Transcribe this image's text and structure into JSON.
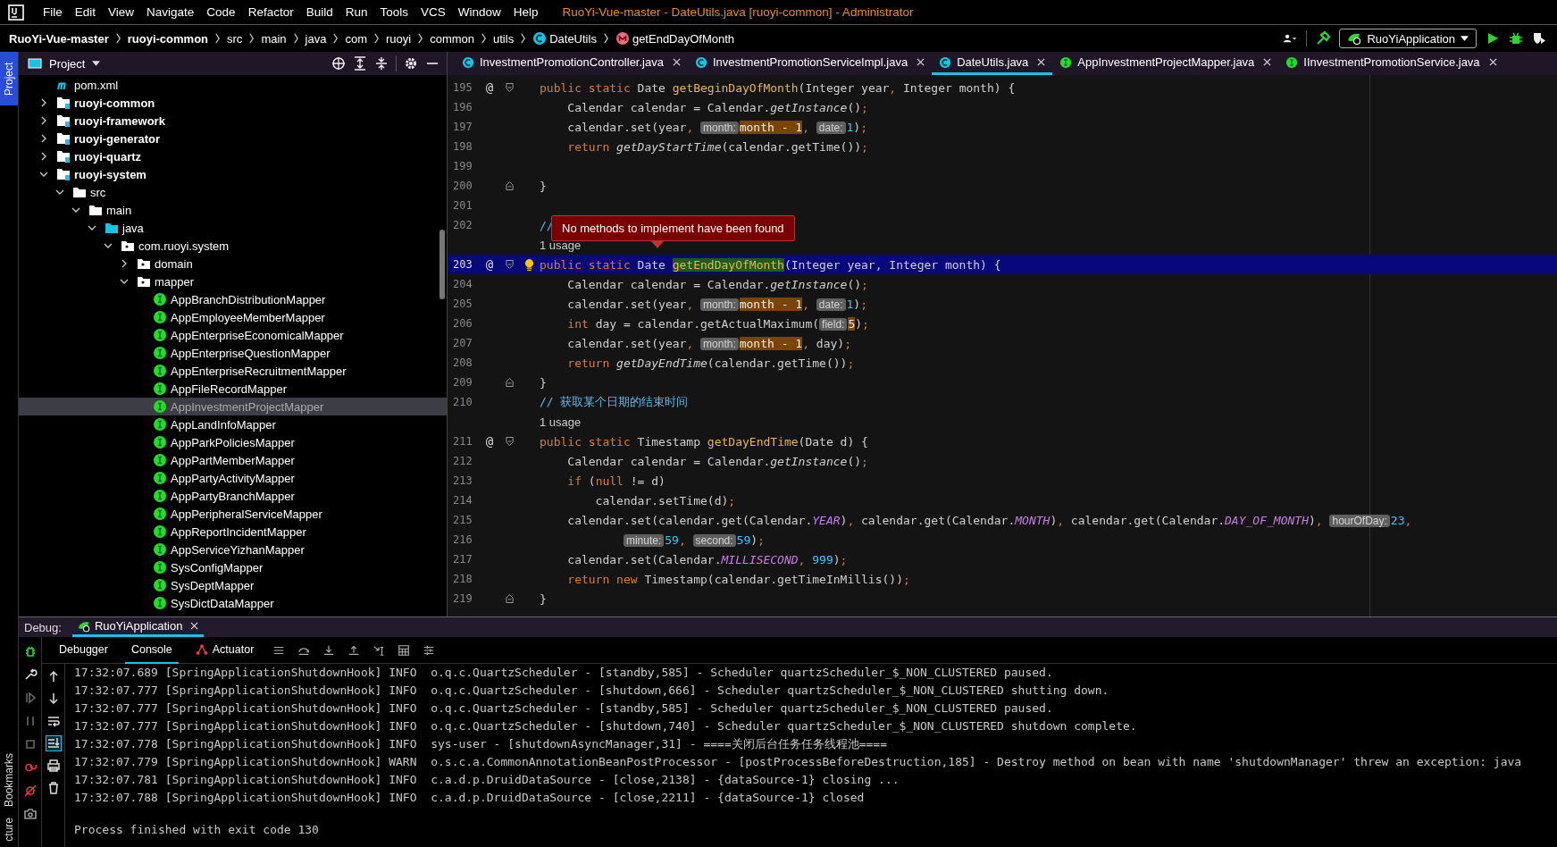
{
  "title_bar": {
    "menu": [
      "File",
      "Edit",
      "View",
      "Navigate",
      "Code",
      "Refactor",
      "Build",
      "Run",
      "Tools",
      "VCS",
      "Window",
      "Help"
    ],
    "title": "RuoYi-Vue-master - DateUtils.java [ruoyi-common] - Administrator"
  },
  "breadcrumb": [
    {
      "label": "RuoYi-Vue-master",
      "kind": "project"
    },
    {
      "label": "ruoyi-common",
      "kind": "project"
    },
    {
      "label": "src",
      "kind": "folder"
    },
    {
      "label": "main",
      "kind": "folder"
    },
    {
      "label": "java",
      "kind": "folder"
    },
    {
      "label": "com",
      "kind": "folder"
    },
    {
      "label": "ruoyi",
      "kind": "folder"
    },
    {
      "label": "common",
      "kind": "folder"
    },
    {
      "label": "utils",
      "kind": "folder"
    },
    {
      "label": "DateUtils",
      "kind": "class"
    },
    {
      "label": "getEndDayOfMonth",
      "kind": "method"
    }
  ],
  "run_config": "RuoYiApplication",
  "left_stripe": {
    "top": "Project",
    "bottom": [
      "Bookmarks",
      "cture"
    ]
  },
  "project_panel": {
    "title": "Project",
    "tree": [
      {
        "label": "pom.xml",
        "kind": "maven"
      },
      {
        "label": "ruoyi-common",
        "kind": "module",
        "expanded": false
      },
      {
        "label": "ruoyi-framework",
        "kind": "module",
        "expanded": false
      },
      {
        "label": "ruoyi-generator",
        "kind": "module",
        "expanded": false
      },
      {
        "label": "ruoyi-quartz",
        "kind": "module",
        "expanded": false
      },
      {
        "label": "ruoyi-system",
        "kind": "module",
        "expanded": true,
        "children": [
          {
            "label": "src",
            "kind": "folder",
            "expanded": true,
            "children": [
              {
                "label": "main",
                "kind": "folder",
                "expanded": true,
                "children": [
                  {
                    "label": "java",
                    "kind": "source",
                    "expanded": true,
                    "children": [
                      {
                        "label": "com.ruoyi.system",
                        "kind": "package",
                        "expanded": true,
                        "children": [
                          {
                            "label": "domain",
                            "kind": "package",
                            "expanded": false
                          },
                          {
                            "label": "mapper",
                            "kind": "package",
                            "expanded": true,
                            "children": [
                              {
                                "label": "AppBranchDistributionMapper",
                                "kind": "interface",
                                "selected": false
                              },
                              {
                                "label": "AppEmployeeMemberMapper",
                                "kind": "interface",
                                "selected": false
                              },
                              {
                                "label": "AppEnterpriseEconomicalMapper",
                                "kind": "interface",
                                "selected": false
                              },
                              {
                                "label": "AppEnterpriseQuestionMapper",
                                "kind": "interface",
                                "selected": false
                              },
                              {
                                "label": "AppEnterpriseRecruitmentMapper",
                                "kind": "interface",
                                "selected": false
                              },
                              {
                                "label": "AppFileRecordMapper",
                                "kind": "interface",
                                "selected": false
                              },
                              {
                                "label": "AppInvestmentProjectMapper",
                                "kind": "interface",
                                "selected": true
                              },
                              {
                                "label": "AppLandInfoMapper",
                                "kind": "interface",
                                "selected": false
                              },
                              {
                                "label": "AppParkPoliciesMapper",
                                "kind": "interface",
                                "selected": false
                              },
                              {
                                "label": "AppPartMemberMapper",
                                "kind": "interface",
                                "selected": false
                              },
                              {
                                "label": "AppPartyActivityMapper",
                                "kind": "interface",
                                "selected": false
                              },
                              {
                                "label": "AppPartyBranchMapper",
                                "kind": "interface",
                                "selected": false
                              },
                              {
                                "label": "AppPeripheralServiceMapper",
                                "kind": "interface",
                                "selected": false
                              },
                              {
                                "label": "AppReportIncidentMapper",
                                "kind": "interface",
                                "selected": false
                              },
                              {
                                "label": "AppServiceYizhanMapper",
                                "kind": "interface",
                                "selected": false
                              },
                              {
                                "label": "SysConfigMapper",
                                "kind": "interface",
                                "selected": false
                              },
                              {
                                "label": "SysDeptMapper",
                                "kind": "interface",
                                "selected": false
                              },
                              {
                                "label": "SysDictDataMapper",
                                "kind": "interface",
                                "selected": false
                              }
                            ]
                          }
                        ]
                      }
                    ]
                  }
                ]
              }
            ]
          }
        ]
      }
    ]
  },
  "editor_tabs": [
    {
      "label": "InvestmentPromotionController.java",
      "kind": "class",
      "selected": false
    },
    {
      "label": "InvestmentPromotionServiceImpl.java",
      "kind": "class",
      "selected": false
    },
    {
      "label": "DateUtils.java",
      "kind": "class",
      "selected": true
    },
    {
      "label": "AppInvestmentProjectMapper.java",
      "kind": "interface",
      "selected": false
    },
    {
      "label": "IInvestmentPromotionService.java",
      "kind": "interface",
      "selected": false
    }
  ],
  "editor": {
    "tooltip": "No methods to implement have been found",
    "lines": [
      {
        "kind": "code",
        "number": "195",
        "gutter": "@",
        "fold_start": true,
        "current": false,
        "tokens": [
          {
            "kind": "kw",
            "text": "public static "
          },
          {
            "kind": "plain",
            "text": "Date "
          },
          {
            "kind": "decl",
            "text": "getBeginDayOfMonth"
          },
          {
            "kind": "plain",
            "text": "(Integer year"
          },
          {
            "kind": "punct",
            "text": ", "
          },
          {
            "kind": "plain",
            "text": "Integer month) {"
          }
        ]
      },
      {
        "kind": "code",
        "number": "196",
        "current": false,
        "tokens": [
          {
            "kind": "plain",
            "text": "    Calendar calendar = Calendar."
          },
          {
            "kind": "italic",
            "text": "getInstance"
          },
          {
            "kind": "plain",
            "text": "()"
          },
          {
            "kind": "punct",
            "text": ";"
          }
        ]
      },
      {
        "kind": "code",
        "number": "197",
        "current": false,
        "tokens": [
          {
            "kind": "plain",
            "text": "    calendar.set(year"
          },
          {
            "kind": "punct",
            "text": ", "
          },
          {
            "kind": "hint",
            "text": "month:"
          },
          {
            "kind": "arg",
            "text": "month - 1"
          },
          {
            "kind": "punct",
            "text": ", "
          },
          {
            "kind": "hint",
            "text": "date:"
          },
          {
            "kind": "num",
            "text": "1"
          },
          {
            "kind": "plain",
            "text": ")"
          },
          {
            "kind": "punct",
            "text": ";"
          }
        ]
      },
      {
        "kind": "code",
        "number": "198",
        "current": false,
        "tokens": [
          {
            "kind": "kw",
            "text": "    return "
          },
          {
            "kind": "italic",
            "text": "getDayStartTime"
          },
          {
            "kind": "plain",
            "text": "(calendar.getTime())"
          },
          {
            "kind": "punct",
            "text": ";"
          }
        ]
      },
      {
        "kind": "code",
        "number": "199",
        "current": false
      },
      {
        "kind": "code",
        "number": "200",
        "fold_end": true,
        "current": false,
        "tokens": [
          {
            "kind": "plain",
            "text": "}"
          }
        ]
      },
      {
        "kind": "code",
        "number": "201",
        "current": false
      },
      {
        "kind": "code",
        "number": "202",
        "current": false,
        "tokens": [
          {
            "kind": "comment",
            "text": "//"
          }
        ]
      },
      {
        "kind": "usage",
        "text": "1 usage"
      },
      {
        "kind": "code",
        "number": "203",
        "gutter": "@",
        "fold_start": true,
        "bulb": true,
        "current": true,
        "tokens": [
          {
            "kind": "kw",
            "text": "public static "
          },
          {
            "kind": "plain",
            "text": "Date "
          },
          {
            "kind": "match",
            "text": "getEndDayOfMonth"
          },
          {
            "kind": "plain",
            "text": "(Integer year, Integer month) {"
          }
        ]
      },
      {
        "kind": "code",
        "number": "204",
        "current": false,
        "tokens": [
          {
            "kind": "plain",
            "text": "    Calendar calendar = Calendar."
          },
          {
            "kind": "italic",
            "text": "getInstance"
          },
          {
            "kind": "plain",
            "text": "()"
          },
          {
            "kind": "punct",
            "text": ";"
          }
        ]
      },
      {
        "kind": "code",
        "number": "205",
        "current": false,
        "tokens": [
          {
            "kind": "plain",
            "text": "    calendar.set(year"
          },
          {
            "kind": "punct",
            "text": ", "
          },
          {
            "kind": "hint",
            "text": "month:"
          },
          {
            "kind": "arg",
            "text": "month - 1"
          },
          {
            "kind": "punct",
            "text": ", "
          },
          {
            "kind": "hint",
            "text": "date:"
          },
          {
            "kind": "num",
            "text": "1"
          },
          {
            "kind": "plain",
            "text": ")"
          },
          {
            "kind": "punct",
            "text": ";"
          }
        ]
      },
      {
        "kind": "code",
        "number": "206",
        "current": false,
        "tokens": [
          {
            "kind": "kw",
            "text": "    int "
          },
          {
            "kind": "plain",
            "text": "day = calendar.getActualMaximum("
          },
          {
            "kind": "hint",
            "text": "field:"
          },
          {
            "kind": "arg",
            "text": "5"
          },
          {
            "kind": "plain",
            "text": ")"
          },
          {
            "kind": "punct",
            "text": ";"
          }
        ]
      },
      {
        "kind": "code",
        "number": "207",
        "current": false,
        "tokens": [
          {
            "kind": "plain",
            "text": "    calendar.set(year"
          },
          {
            "kind": "punct",
            "text": ", "
          },
          {
            "kind": "hint",
            "text": "month:"
          },
          {
            "kind": "arg",
            "text": "month - 1"
          },
          {
            "kind": "punct",
            "text": ", "
          },
          {
            "kind": "plain",
            "text": "day)"
          },
          {
            "kind": "punct",
            "text": ";"
          }
        ]
      },
      {
        "kind": "code",
        "number": "208",
        "current": false,
        "tokens": [
          {
            "kind": "kw",
            "text": "    return "
          },
          {
            "kind": "italic",
            "text": "getDayEndTime"
          },
          {
            "kind": "plain",
            "text": "(calendar.getTime())"
          },
          {
            "kind": "punct",
            "text": ";"
          }
        ]
      },
      {
        "kind": "code",
        "number": "209",
        "fold_end": true,
        "current": false,
        "tokens": [
          {
            "kind": "plain",
            "text": "}"
          }
        ]
      },
      {
        "kind": "code",
        "number": "210",
        "current": false,
        "tokens": [
          {
            "kind": "comment",
            "text": "// 获取某个日期的结束时间"
          }
        ]
      },
      {
        "kind": "usage",
        "text": "1 usage"
      },
      {
        "kind": "code",
        "number": "211",
        "gutter": "@",
        "fold_start": true,
        "current": false,
        "tokens": [
          {
            "kind": "kw",
            "text": "public static "
          },
          {
            "kind": "plain",
            "text": "Timestamp "
          },
          {
            "kind": "decl",
            "text": "getDayEndTime"
          },
          {
            "kind": "plain",
            "text": "(Date d) {"
          }
        ]
      },
      {
        "kind": "code",
        "number": "212",
        "current": false,
        "tokens": [
          {
            "kind": "plain",
            "text": "    Calendar calendar = Calendar."
          },
          {
            "kind": "italic",
            "text": "getInstance"
          },
          {
            "kind": "plain",
            "text": "()"
          },
          {
            "kind": "punct",
            "text": ";"
          }
        ]
      },
      {
        "kind": "code",
        "number": "213",
        "current": false,
        "tokens": [
          {
            "kind": "kw",
            "text": "    if "
          },
          {
            "kind": "plain",
            "text": "("
          },
          {
            "kind": "kw",
            "text": "null"
          },
          {
            "kind": "plain",
            "text": " != d)"
          }
        ]
      },
      {
        "kind": "code",
        "number": "214",
        "current": false,
        "tokens": [
          {
            "kind": "plain",
            "text": "        calendar.setTime(d)"
          },
          {
            "kind": "punct",
            "text": ";"
          }
        ]
      },
      {
        "kind": "code",
        "number": "215",
        "current": false,
        "tokens": [
          {
            "kind": "plain",
            "text": "    calendar.set(calendar.get(Calendar."
          },
          {
            "kind": "const",
            "text": "YEAR"
          },
          {
            "kind": "plain",
            "text": ")"
          },
          {
            "kind": "punct",
            "text": ", "
          },
          {
            "kind": "plain",
            "text": "calendar.get(Calendar."
          },
          {
            "kind": "const",
            "text": "MONTH"
          },
          {
            "kind": "plain",
            "text": ")"
          },
          {
            "kind": "punct",
            "text": ", "
          },
          {
            "kind": "plain",
            "text": "calendar.get(Calendar."
          },
          {
            "kind": "const",
            "text": "DAY_OF_MONTH"
          },
          {
            "kind": "plain",
            "text": ")"
          },
          {
            "kind": "punct",
            "text": ", "
          },
          {
            "kind": "hint",
            "text": "hourOfDay:"
          },
          {
            "kind": "num",
            "text": "23"
          },
          {
            "kind": "punct",
            "text": ","
          }
        ]
      },
      {
        "kind": "code",
        "number": "216",
        "current": false,
        "continuation": true,
        "tokens": [
          {
            "kind": "hint",
            "text": "minute:"
          },
          {
            "kind": "num",
            "text": "59"
          },
          {
            "kind": "punct",
            "text": ", "
          },
          {
            "kind": "hint",
            "text": "second:"
          },
          {
            "kind": "num",
            "text": "59"
          },
          {
            "kind": "plain",
            "text": ")"
          },
          {
            "kind": "punct",
            "text": ";"
          }
        ]
      },
      {
        "kind": "code",
        "number": "217",
        "current": false,
        "tokens": [
          {
            "kind": "plain",
            "text": "    calendar.set(Calendar."
          },
          {
            "kind": "const",
            "text": "MILLISECOND"
          },
          {
            "kind": "punct",
            "text": ", "
          },
          {
            "kind": "num",
            "text": "999"
          },
          {
            "kind": "plain",
            "text": ")"
          },
          {
            "kind": "punct",
            "text": ";"
          }
        ]
      },
      {
        "kind": "code",
        "number": "218",
        "current": false,
        "tokens": [
          {
            "kind": "kw",
            "text": "    return new "
          },
          {
            "kind": "plain",
            "text": "Timestamp(calendar.getTimeInMillis())"
          },
          {
            "kind": "punct",
            "text": ";"
          }
        ]
      },
      {
        "kind": "code",
        "number": "219",
        "fold_end": true,
        "current": false,
        "tokens": [
          {
            "kind": "plain",
            "text": "}"
          }
        ]
      }
    ]
  },
  "debug": {
    "label": "Debug:",
    "session": "RuoYiApplication",
    "toolbar_tabs": [
      {
        "label": "Debugger",
        "kind": "plain",
        "selected": false
      },
      {
        "label": "Console",
        "kind": "plain",
        "selected": true
      },
      {
        "label": "Actuator",
        "kind": "actuator",
        "selected": false
      }
    ],
    "console": [
      "17:32:07.689 [SpringApplicationShutdownHook] INFO  o.q.c.QuartzScheduler - [standby,585] - Scheduler quartzScheduler_$_NON_CLUSTERED paused.",
      "17:32:07.777 [SpringApplicationShutdownHook] INFO  o.q.c.QuartzScheduler - [shutdown,666] - Scheduler quartzScheduler_$_NON_CLUSTERED shutting down.",
      "17:32:07.777 [SpringApplicationShutdownHook] INFO  o.q.c.QuartzScheduler - [standby,585] - Scheduler quartzScheduler_$_NON_CLUSTERED paused.",
      "17:32:07.777 [SpringApplicationShutdownHook] INFO  o.q.c.QuartzScheduler - [shutdown,740] - Scheduler quartzScheduler_$_NON_CLUSTERED shutdown complete.",
      "17:32:07.778 [SpringApplicationShutdownHook] INFO  sys-user - [shutdownAsyncManager,31] - ====关闭后台任务任务线程池====",
      "17:32:07.779 [SpringApplicationShutdownHook] WARN  o.s.c.a.CommonAnnotationBeanPostProcessor - [postProcessBeforeDestruction,185] - Destroy method on bean with name 'shutdownManager' threw an exception: java",
      "17:32:07.781 [SpringApplicationShutdownHook] INFO  c.a.d.p.DruidDataSource - [close,2138] - {dataSource-1} closing ...",
      "17:32:07.788 [SpringApplicationShutdownHook] INFO  c.a.d.p.DruidDataSource - [close,2211] - {dataSource-1} closed",
      "Process finished with exit code 130"
    ]
  }
}
